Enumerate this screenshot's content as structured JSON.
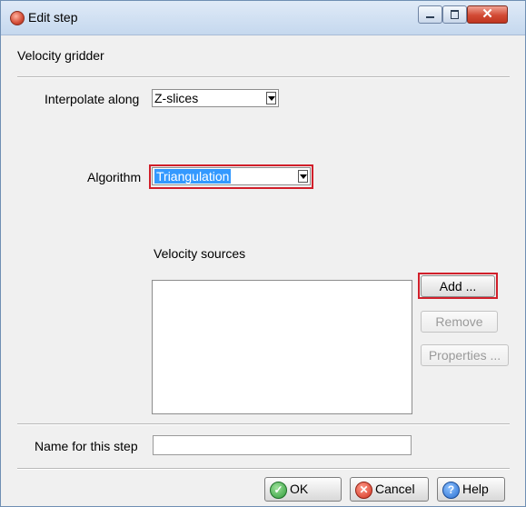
{
  "window": {
    "title": "Edit step",
    "close_glyph": "✕"
  },
  "step_type": "Velocity gridder",
  "interpolate": {
    "label": "Interpolate along",
    "value": "Z-slices"
  },
  "algorithm": {
    "label": "Algorithm",
    "value": "Triangulation"
  },
  "velocity_sources": {
    "label": "Velocity sources",
    "items": []
  },
  "side_buttons": {
    "add": "Add ...",
    "remove": "Remove",
    "properties": "Properties ..."
  },
  "name_field": {
    "label": "Name for this step",
    "value": ""
  },
  "footer": {
    "ok": "OK",
    "cancel": "Cancel",
    "help": "Help"
  },
  "icons": {
    "ok": "check-icon",
    "cancel": "x-icon",
    "help": "question-icon"
  },
  "colors": {
    "highlight": "#d11f2a",
    "selection": "#3399ff"
  }
}
